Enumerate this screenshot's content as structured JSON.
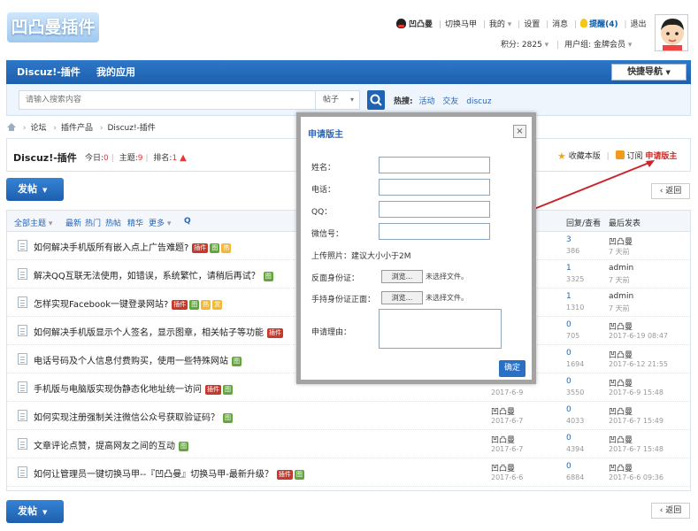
{
  "header": {
    "logo_text": "凹凸曼插件",
    "username": "凹凸曼",
    "links": [
      "切换马甲",
      "我的",
      "设置",
      "消息"
    ],
    "remind_label": "提醒(4)",
    "logout_label": "退出",
    "credits_label": "积分: 2825",
    "usergroup_label": "用户组: 金牌会员"
  },
  "nav": {
    "items": [
      "Discuz!-插件",
      "我的应用"
    ],
    "quick_nav_label": "快捷导航"
  },
  "search": {
    "placeholder": "请输入搜索内容",
    "type_label": "帖子",
    "hot_label": "热搜:",
    "hot_links": [
      "活动",
      "交友",
      "discuz"
    ]
  },
  "breadcrumb": [
    "论坛",
    "插件产品",
    "Discuz!-插件"
  ],
  "forum": {
    "title": "Discuz!-插件",
    "today_label": "今日:",
    "today_value": "0",
    "topics_label": "主题:",
    "topics_value": "9",
    "rank_label": "排名:",
    "rank_value": "1",
    "favorite_label": "收藏本版",
    "subscribe_label": "订阅",
    "apply_label": "申请版主"
  },
  "buttons": {
    "post_label": "发帖",
    "back_label": "返回"
  },
  "filters": {
    "items": [
      "全部主题",
      "最新",
      "热门",
      "热帖",
      "精华",
      "更多"
    ],
    "col_replies": "回复/查看",
    "col_last": "最后发表"
  },
  "threads": [
    {
      "title": "如何解决手机版所有嵌入点上广告难题?",
      "tags": [
        "red:插件",
        "green:图",
        "gold:热"
      ],
      "author": "",
      "date": "",
      "replies": "3",
      "views": "386",
      "last_user": "凹凸曼",
      "last_date": "7 天前"
    },
    {
      "title": "解决QQ互联无法使用，如错误，系统繁忙，请稍后再试？",
      "tags": [
        "green:图"
      ],
      "author": "",
      "date": "",
      "replies": "1",
      "views": "3325",
      "last_user": "admin",
      "last_date": "7 天前"
    },
    {
      "title": "怎样实现Facebook一键登录网站?",
      "tags": [
        "red:插件",
        "green:图",
        "gold:热",
        "gold:赏"
      ],
      "author": "",
      "date": "",
      "replies": "1",
      "views": "1310",
      "last_user": "admin",
      "last_date": "7 天前"
    },
    {
      "title": "如何解决手机版显示个人签名，显示图章，相关帖子等功能",
      "tags": [
        "red:插件"
      ],
      "author": "",
      "date": "",
      "replies": "0",
      "views": "705",
      "last_user": "凹凸曼",
      "last_date": "2017-6-19 08:47"
    },
    {
      "title": "电话号码及个人信息付费购买，使用一些特殊网站",
      "tags": [
        "green:图"
      ],
      "author": "",
      "date": "",
      "replies": "0",
      "views": "1694",
      "last_user": "凹凸曼",
      "last_date": "2017-6-12 21:55"
    },
    {
      "title": "手机版与电脑版实现伪静态化地址统一访问",
      "tags": [
        "red:插件",
        "green:图"
      ],
      "author": "",
      "date": "2017-6-9",
      "replies": "0",
      "views": "3550",
      "last_user": "凹凸曼",
      "last_date": "2017-6-9 15:48"
    },
    {
      "title": "如何实现注册强制关注微信公众号获取验证码？",
      "tags": [
        "green:图"
      ],
      "author": "凹凸曼",
      "date": "2017-6-7",
      "replies": "0",
      "views": "4033",
      "last_user": "凹凸曼",
      "last_date": "2017-6-7 15:49"
    },
    {
      "title": "文章评论点赞，提高网友之间的互动",
      "tags": [
        "green:图"
      ],
      "author": "凹凸曼",
      "date": "2017-6-7",
      "replies": "0",
      "views": "4394",
      "last_user": "凹凸曼",
      "last_date": "2017-6-7 15:48"
    },
    {
      "title": "如何让管理员一键切换马甲--『凹凸曼』切换马甲-最新升级？",
      "tags": [
        "red:插件",
        "green:图"
      ],
      "author": "凹凸曼",
      "date": "2017-6-6",
      "replies": "0",
      "views": "6884",
      "last_user": "凹凸曼",
      "last_date": "2017-6-6 09:36"
    }
  ],
  "modal": {
    "title": "申请版主",
    "close_symbol": "×",
    "fields": [
      "姓名：",
      "电话：",
      "QQ：",
      "微信号："
    ],
    "photo_note": "上传照片：建议大小小于2M",
    "id_front_label": "反面身份证：",
    "id_hand_label": "手持身份证正面：",
    "browse_label": "浏览...",
    "no_file_label": "未选择文件。",
    "reason_label": "申请理由：",
    "submit_label": "确定"
  },
  "colors": {
    "nav_blue": "#1f63b3",
    "accent_red": "#c3322b",
    "link_blue": "#2a66b5"
  }
}
